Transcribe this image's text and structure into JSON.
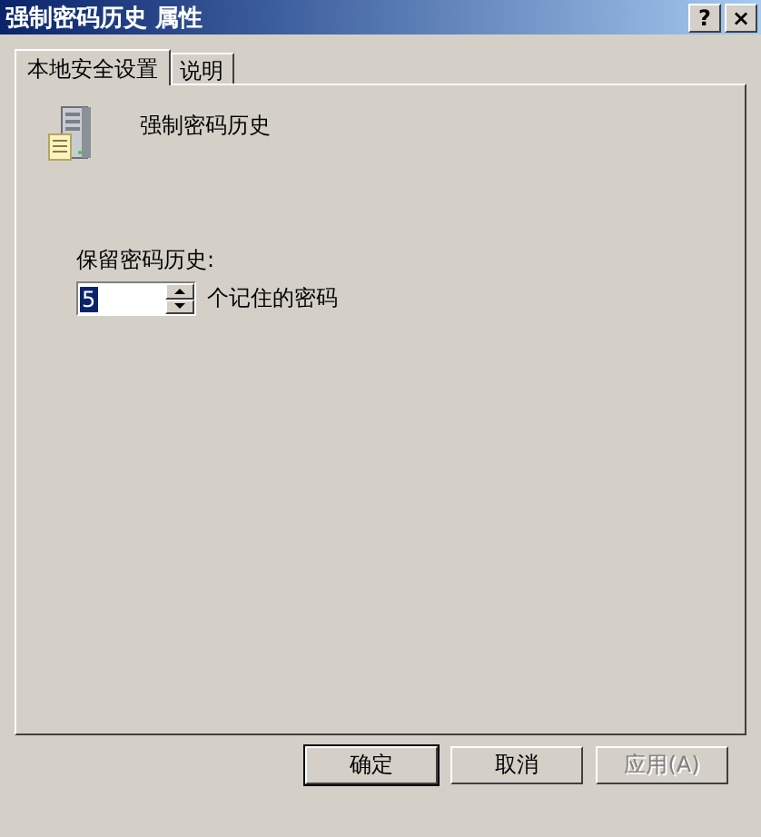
{
  "window": {
    "title": "强制密码历史 属性",
    "title_buttons": [
      "?",
      "×"
    ]
  },
  "tabs": [
    {
      "label": "本地安全设置",
      "selected": true
    },
    {
      "label": "说明",
      "selected": false
    }
  ],
  "policy": {
    "name": "强制密码历史"
  },
  "setting": {
    "label": "保留密码历史:",
    "value": "5",
    "value_selected": true,
    "unit": "个记住的密码"
  },
  "buttons": [
    {
      "label": "确定",
      "default": true,
      "disabled": false
    },
    {
      "label": "取消",
      "default": false,
      "disabled": false
    },
    {
      "label": "应用(A)",
      "default": false,
      "disabled": true
    }
  ]
}
